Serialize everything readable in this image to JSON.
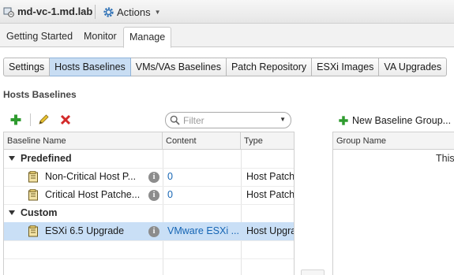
{
  "window": {
    "title": "md-vc-1.md.lab",
    "title_icon": "vcenter-host-icon",
    "actions_label": "Actions"
  },
  "main_tabs": [
    {
      "label": "Getting Started",
      "active": false
    },
    {
      "label": "Monitor",
      "active": false
    },
    {
      "label": "Manage",
      "active": true
    }
  ],
  "sub_tabs": [
    {
      "label": "Settings",
      "active": false
    },
    {
      "label": "Hosts Baselines",
      "active": true
    },
    {
      "label": "VMs/VAs Baselines",
      "active": false
    },
    {
      "label": "Patch Repository",
      "active": false
    },
    {
      "label": "ESXi Images",
      "active": false
    },
    {
      "label": "VA Upgrades",
      "active": false
    }
  ],
  "section_title": "Hosts Baselines",
  "toolbar": {
    "icons": [
      "add-icon",
      "edit-icon",
      "delete-icon"
    ],
    "filter_placeholder": "Filter"
  },
  "baselines_table": {
    "columns": [
      "Baseline Name",
      "Content",
      "Type"
    ],
    "groups": [
      {
        "name": "Predefined",
        "rows": [
          {
            "name": "Non-Critical Host P...",
            "content": "0",
            "type": "Host Patch",
            "selected": false
          },
          {
            "name": "Critical Host Patche...",
            "content": "0",
            "type": "Host Patch",
            "selected": false
          }
        ]
      },
      {
        "name": "Custom",
        "rows": [
          {
            "name": "ESXi 6.5 Upgrade",
            "content": "VMware ESXi ...",
            "type": "Host Upgra",
            "selected": true
          }
        ]
      }
    ]
  },
  "baseline_groups": {
    "new_button_label": "New Baseline Group...",
    "columns": [
      "Group Name"
    ],
    "message": "This"
  },
  "colors": {
    "accent_selection": "#c9dff6",
    "active_tab": "#c8ddf3",
    "link": "#1565b4",
    "add_green": "#2f9b2f",
    "delete_red": "#d32a2a"
  }
}
